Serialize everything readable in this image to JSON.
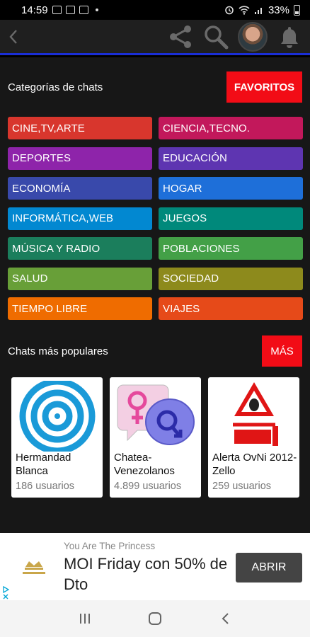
{
  "status": {
    "time": "14:59",
    "battery": "33%"
  },
  "categories_section": {
    "title": "Categorías de chats",
    "favorites_label": "FAVORITOS"
  },
  "categories": [
    {
      "label": "CINE,TV,ARTE",
      "color": "#d8362d"
    },
    {
      "label": "CIENCIA,TECNO.",
      "color": "#c2185b"
    },
    {
      "label": "DEPORTES",
      "color": "#8e24aa"
    },
    {
      "label": "EDUCACIÓN",
      "color": "#5e35b1"
    },
    {
      "label": "ECONOMÍA",
      "color": "#3949ab"
    },
    {
      "label": "HOGAR",
      "color": "#1e6fd9"
    },
    {
      "label": "INFORMÁTICA,WEB",
      "color": "#0288d1"
    },
    {
      "label": "JUEGOS",
      "color": "#00897b"
    },
    {
      "label": "MÚSICA Y RADIO",
      "color": "#1b7e5c"
    },
    {
      "label": "POBLACIONES",
      "color": "#43a047"
    },
    {
      "label": "SALUD",
      "color": "#689f38"
    },
    {
      "label": "SOCIEDAD",
      "color": "#8d8a1c"
    },
    {
      "label": "TIEMPO LIBRE",
      "color": "#ef6c00"
    },
    {
      "label": "VIAJES",
      "color": "#e64a19"
    }
  ],
  "popular_section": {
    "title": "Chats más populares",
    "more_label": "MÁS"
  },
  "popular_chats": [
    {
      "name": "Hermandad Blanca",
      "users": "186 usuarios",
      "icon": "target-circles-icon"
    },
    {
      "name": "Chatea-Venezolanos",
      "users": "4.899 usuarios",
      "icon": "gender-bubbles-icon"
    },
    {
      "name": "Alerta OvNi 2012-Zello",
      "users": "259 usuarios",
      "icon": "ovni-alert-icon"
    }
  ],
  "ad": {
    "subtitle": "You Are The Princess",
    "headline": "MOI Friday con 50% de Dto",
    "cta": "ABRIR"
  }
}
